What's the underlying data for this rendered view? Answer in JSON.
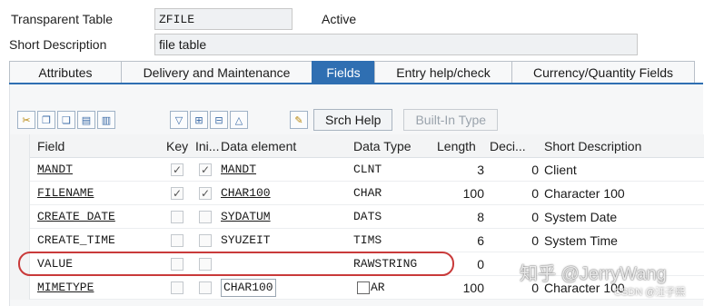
{
  "header": {
    "table_label": "Transparent Table",
    "table_name": "ZFILE",
    "status": "Active",
    "short_desc_label": "Short Description",
    "short_desc_value": "file table"
  },
  "tabs": [
    {
      "label": "Attributes",
      "active": false
    },
    {
      "label": "Delivery and Maintenance",
      "active": false
    },
    {
      "label": "Fields",
      "active": true
    },
    {
      "label": "Entry help/check",
      "active": false
    },
    {
      "label": "Currency/Quantity Fields",
      "active": false
    }
  ],
  "toolbar": {
    "icons": [
      "cut-icon",
      "copy-icon",
      "paste-icon",
      "insert-row-icon",
      "delete-row-icon",
      "filter-down-icon",
      "expand-icon",
      "collapse-icon",
      "up-icon",
      "where-used-icon"
    ],
    "srch_help_label": "Srch Help",
    "builtin_type_label": "Built-In Type"
  },
  "columns": [
    "Field",
    "Key",
    "Ini...",
    "Data element",
    "Data Type",
    "Length",
    "Deci...",
    "Short Description"
  ],
  "rows": [
    {
      "field": "MANDT",
      "key": true,
      "ini": true,
      "data_element": "MANDT",
      "data_type": "CLNT",
      "length": "3",
      "decimals": "0",
      "desc": "Client"
    },
    {
      "field": "FILENAME",
      "key": true,
      "ini": true,
      "data_element": "CHAR100",
      "data_type": "CHAR",
      "length": "100",
      "decimals": "0",
      "desc": "Character 100"
    },
    {
      "field": "CREATE_DATE",
      "key": false,
      "ini": false,
      "data_element": "SYDATUM",
      "data_type": "DATS",
      "length": "8",
      "decimals": "0",
      "desc": "System Date"
    },
    {
      "field": "CREATE_TIME",
      "key": false,
      "ini": false,
      "data_element": "SYUZEIT",
      "data_type": "TIMS",
      "length": "6",
      "decimals": "0",
      "desc": "System Time"
    },
    {
      "field": "VALUE",
      "key": false,
      "ini": false,
      "data_element": "",
      "data_type": "RAWSTRING",
      "length": "0",
      "decimals": "",
      "desc": ""
    },
    {
      "field": "MIMETYPE",
      "key": false,
      "ini": false,
      "data_element": "CHAR100",
      "data_type": "AR",
      "length": "100",
      "decimals": "0",
      "desc": "Character 100"
    }
  ],
  "watermark": {
    "main": "知乎 @JerryWang",
    "sub": "CSDN @汪子熙"
  },
  "colors": {
    "active_tab": "#2f6fb2",
    "highlight": "#c93a3a"
  }
}
